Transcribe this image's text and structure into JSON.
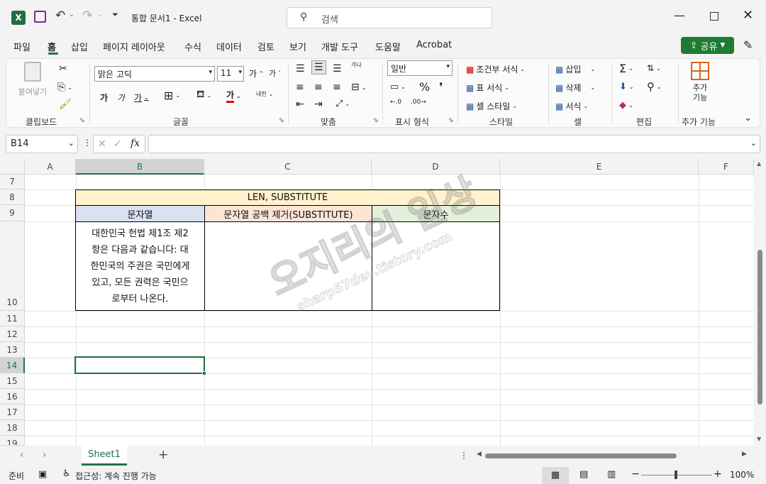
{
  "app": {
    "title": "통합 문서1",
    "app_name": "Excel",
    "search_placeholder": "검색"
  },
  "menu": [
    "파일",
    "홈",
    "삽입",
    "페이지 레이아웃",
    "수식",
    "데이터",
    "검토",
    "보기",
    "개발 도구",
    "도움말",
    "Acrobat"
  ],
  "active_menu": "홈",
  "share_label": "공유",
  "ribbon": {
    "clipboard": {
      "paste": "붙여넣기",
      "label": "클립보드"
    },
    "font": {
      "name": "맑은 고딕",
      "size": "11",
      "label": "글꼴",
      "bold": "가",
      "italic": "가",
      "underline": "가",
      "font_color": "가",
      "grow": "가",
      "shrink": "가",
      "phonetic": "내천"
    },
    "align": {
      "label": "맞춤",
      "wrap": "가나"
    },
    "number": {
      "format": "일반",
      "label": "표시 형식"
    },
    "styles": {
      "conditional": "조건부 서식",
      "table": "표 서식",
      "cell": "셀 스타일",
      "label": "스타일"
    },
    "cells": {
      "insert": "삽입",
      "delete": "삭제",
      "format": "서식",
      "label": "셀"
    },
    "editing": {
      "label": "편집"
    },
    "addins": {
      "button": "추가 기능",
      "label": "추가 기능"
    }
  },
  "formula_bar": {
    "name_box": "B14",
    "fx": "fx",
    "value": ""
  },
  "columns": [
    "A",
    "B",
    "C",
    "D",
    "E",
    "F"
  ],
  "rows": [
    "7",
    "8",
    "9",
    "10",
    "11",
    "12",
    "13",
    "14",
    "15",
    "16",
    "17",
    "18",
    "19"
  ],
  "sheet": {
    "title_cell": "LEN, SUBSTITUTE",
    "headers": [
      "문자열",
      "문자열 공백 제거(SUBSTITUTE)",
      "문자수"
    ],
    "header_colors": [
      "#d9e1f2",
      "#fce4d6",
      "#e2efda"
    ],
    "title_color": "#fff2cc",
    "text_lines": [
      "대한민국 헌법 제1조 제2",
      "항은 다음과 같습니다: 대",
      "한민국의 주권은 국민에게",
      "있고, 모든 권력은 국민으",
      "로부터 나온다."
    ]
  },
  "watermark": {
    "main": "오지리의 일상",
    "sub": "sharp57dev.tistory.com"
  },
  "tabs": [
    "Sheet1"
  ],
  "status": {
    "ready": "준비",
    "accessibility": "접근성: 계속 진행 가능",
    "zoom": "100%"
  },
  "colors": {
    "excel_green": "#217346",
    "share_green": "#1e7b34",
    "selection": "#217346"
  }
}
